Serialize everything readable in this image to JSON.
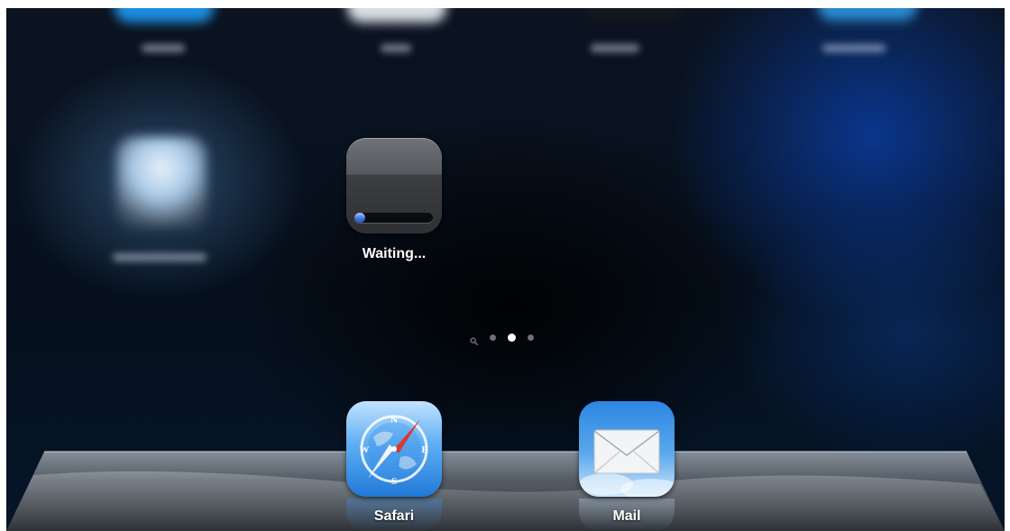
{
  "home_screen": {
    "pending_app": {
      "status_label": "Waiting...",
      "download_progress": 0.14
    },
    "page_indicator": {
      "pages": 3,
      "current_page": 2,
      "has_spotlight": true
    },
    "dock": {
      "apps": [
        {
          "label": "Safari",
          "icon": "safari-compass-icon"
        },
        {
          "label": "Mail",
          "icon": "mail-envelope-icon"
        }
      ]
    }
  },
  "colors": {
    "background": "#06101d",
    "progress": "#3a6fe0",
    "label": "#ffffff"
  }
}
